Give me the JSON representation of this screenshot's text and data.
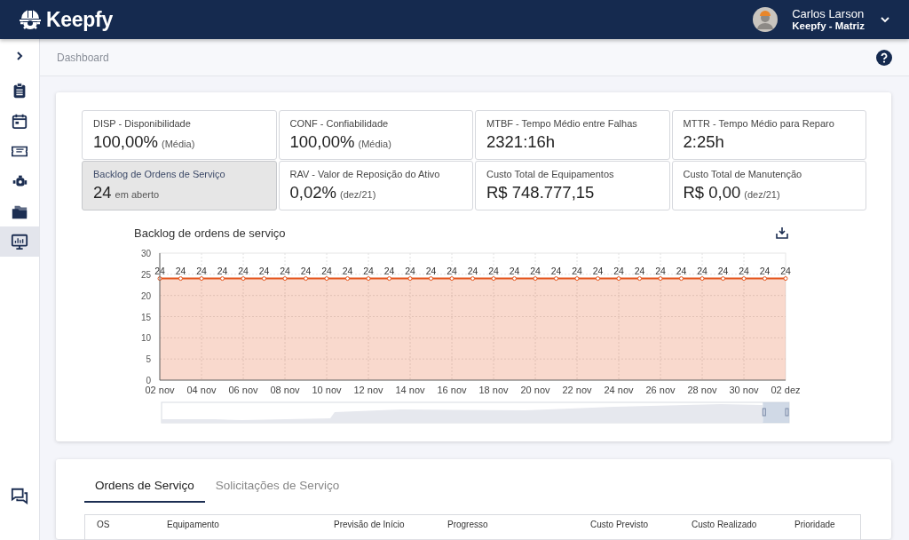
{
  "header": {
    "brand": "Keepfy",
    "user": {
      "name": "Carlos Larson",
      "unit": "Keepfy - Matriz"
    }
  },
  "sidebar": {
    "items": [
      {
        "selected": false
      },
      {
        "selected": false
      },
      {
        "selected": false
      },
      {
        "selected": false
      },
      {
        "selected": false
      },
      {
        "selected": true
      }
    ]
  },
  "breadcrumb": "Dashboard",
  "stats": [
    {
      "label": "DISP - Disponibilidade",
      "value": "100,00%",
      "note": "(Média)",
      "selected": false
    },
    {
      "label": "CONF - Confiabilidade",
      "value": "100,00%",
      "note": "(Média)",
      "selected": false
    },
    {
      "label": "MTBF - Tempo Médio entre Falhas",
      "value": "2321:16h",
      "selected": false
    },
    {
      "label": "MTTR - Tempo Médio para Reparo",
      "value": "2:25h",
      "selected": false
    },
    {
      "label": "Backlog de Ordens de Serviço",
      "value": "24",
      "note": "em aberto",
      "selected": true
    },
    {
      "label": "RAV - Valor de Reposição do Ativo",
      "value": "0,02%",
      "note": "(dez/21)",
      "selected": false
    },
    {
      "label": "Custo Total de Equipamentos",
      "value": "R$ 748.777,15",
      "selected": false
    },
    {
      "label": "Custo Total de Manutenção",
      "value": "R$ 0,00",
      "note": "(dez/21)",
      "selected": false
    }
  ],
  "chart": {
    "title": "Backlog de ordens de serviço",
    "chart_data": {
      "type": "area",
      "categories": [
        "02 nov",
        null,
        "04 nov",
        null,
        "06 nov",
        null,
        "08 nov",
        null,
        "10 nov",
        null,
        "12 nov",
        null,
        "14 nov",
        null,
        "16 nov",
        null,
        "18 nov",
        null,
        "20 nov",
        null,
        "22 nov",
        null,
        "24 nov",
        null,
        "26 nov",
        null,
        "28 nov",
        null,
        "30 nov",
        null,
        "02 dez"
      ],
      "series": [
        {
          "color": "#e4541c",
          "values": [
            24,
            24,
            24,
            24,
            24,
            24,
            24,
            24,
            24,
            24,
            24,
            24,
            24,
            24,
            24,
            24,
            24,
            24,
            24,
            24,
            24,
            24,
            24,
            24,
            24,
            24,
            24,
            24,
            24,
            24,
            24
          ]
        }
      ],
      "ylim": [
        0,
        30
      ],
      "yticks": [
        0,
        5,
        10,
        15,
        20,
        25,
        30
      ],
      "data_labels": true,
      "grid": true
    },
    "range_slider": {
      "level": 0.042
    }
  },
  "tabs": [
    {
      "label": "Ordens de Serviço",
      "selected": true
    },
    {
      "label": "Solicitações de Serviço",
      "selected": false
    }
  ],
  "table": {
    "columns": [
      "OS",
      "Equipamento",
      "Previsão de Início",
      "Progresso",
      "Custo Previsto",
      "Custo Realizado",
      "Prioridade"
    ]
  }
}
